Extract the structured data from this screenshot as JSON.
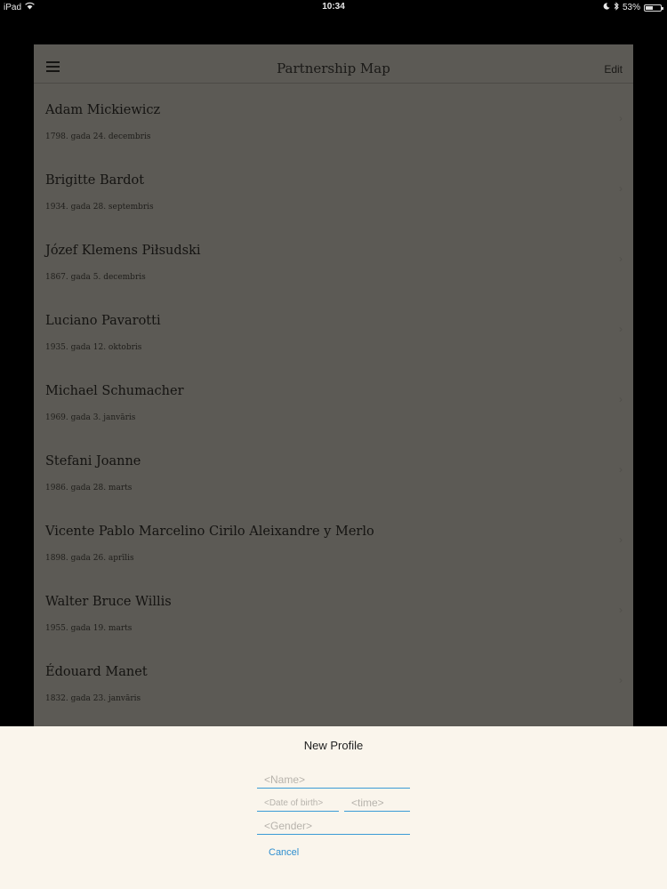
{
  "status_bar": {
    "device": "iPad",
    "time": "10:34",
    "battery_percent_label": "53%",
    "battery_level": 0.53,
    "icons": [
      "wifi-icon",
      "moon-icon",
      "bluetooth-icon",
      "battery-icon"
    ]
  },
  "navbar": {
    "title": "Partnership Map",
    "edit_label": "Edit",
    "menu_icon": "hamburger-icon"
  },
  "profiles": [
    {
      "name": "Adam Mickiewicz",
      "date": "1798. gada 24. decembris"
    },
    {
      "name": "Brigitte Bardot",
      "date": "1934. gada 28. septembris"
    },
    {
      "name": "Józef Klemens Piłsudski",
      "date": "1867. gada 5. decembris"
    },
    {
      "name": "Luciano Pavarotti",
      "date": "1935. gada 12. oktobris"
    },
    {
      "name": "Michael Schumacher",
      "date": "1969. gada 3. janvāris"
    },
    {
      "name": "Stefani Joanne",
      "date": "1986. gada 28. marts"
    },
    {
      "name": "Vicente Pablo Marcelino Cirilo Aleixandre y Merlo",
      "date": "1898. gada 26. aprīlis"
    },
    {
      "name": "Walter Bruce Willis",
      "date": "1955. gada 19. marts"
    },
    {
      "name": "Édouard Manet",
      "date": "1832. gada 23. janvāris"
    }
  ],
  "sheet": {
    "title": "New Profile",
    "name_placeholder": "<Name>",
    "dob_placeholder": "<Date of birth>",
    "time_placeholder": "<time>",
    "gender_placeholder": "<Gender>",
    "cancel_label": "Cancel"
  },
  "colors": {
    "accent": "#3a9bd6",
    "sheet_background": "#faf5ec",
    "dimmed_panel": "#5c5a55"
  }
}
